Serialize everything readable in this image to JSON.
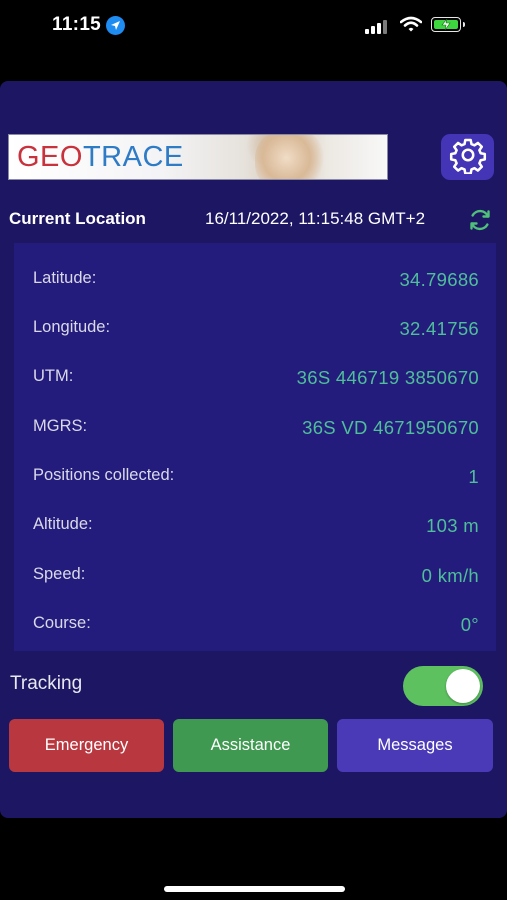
{
  "status_bar": {
    "time": "11:15"
  },
  "app": {
    "logo": {
      "part1": "GEO",
      "part2": "TRACE"
    },
    "settings_icon": "gear-icon",
    "location_header": {
      "title": "Current Location",
      "timestamp": "16/11/2022, 11:15:48 GMT+2",
      "refresh_icon": "refresh-icon"
    },
    "info_rows": [
      {
        "label": "Latitude:",
        "value": "34.79686"
      },
      {
        "label": "Longitude:",
        "value": "32.41756"
      },
      {
        "label": "UTM:",
        "value": "36S 446719 3850670"
      },
      {
        "label": "MGRS:",
        "value": "36S VD 4671950670"
      },
      {
        "label": "Positions collected:",
        "value": "1"
      },
      {
        "label": "Altitude:",
        "value": "103 m"
      },
      {
        "label": "Speed:",
        "value": "0 km/h"
      },
      {
        "label": "Course:",
        "value": "0°"
      }
    ],
    "tracking": {
      "label": "Tracking",
      "enabled": true
    },
    "buttons": {
      "emergency": "Emergency",
      "assistance": "Assistance",
      "messages": "Messages"
    }
  },
  "colors": {
    "panel": "#1d1663",
    "card": "#241c7c",
    "value_green": "#4fbf9a",
    "emergency": "#b93840",
    "assistance": "#3f9950",
    "messages": "#4b3ab8",
    "toggle_on": "#5dc160"
  }
}
